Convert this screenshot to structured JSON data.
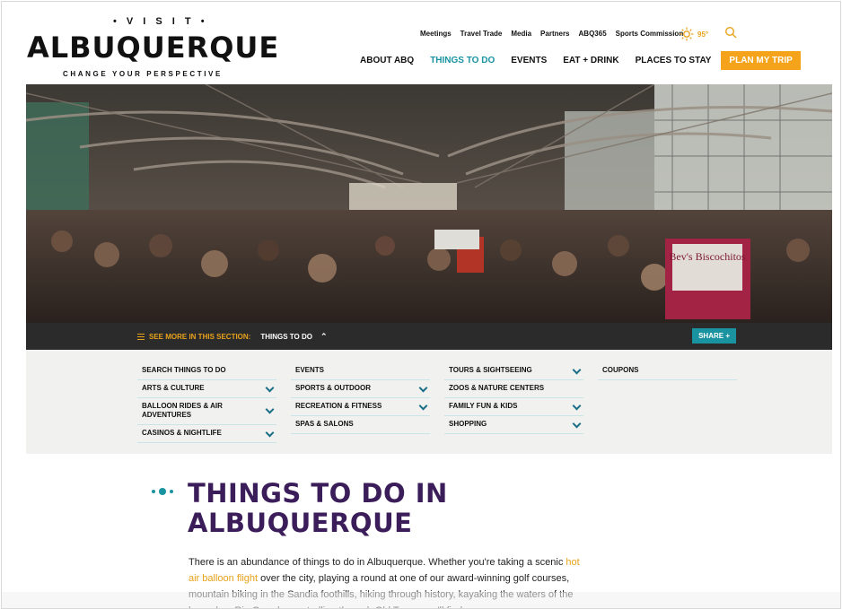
{
  "logo": {
    "visit": "• V I S I T •",
    "name": "ALBUQUERQUE",
    "tagline": "CHANGE YOUR PERSPECTIVE"
  },
  "utility_nav": [
    "Meetings",
    "Travel Trade",
    "Media",
    "Partners",
    "ABQ365",
    "Sports Commission"
  ],
  "weather": {
    "temp": "95°",
    "icon": "sun-icon"
  },
  "main_nav": {
    "items": [
      "ABOUT ABQ",
      "THINGS TO DO",
      "EVENTS",
      "EAT + DRINK",
      "PLACES TO STAY"
    ],
    "active": "THINGS TO DO",
    "cta": "PLAN MY TRIP"
  },
  "hero": {
    "sign": "Bev's Biscochitos"
  },
  "section_bar": {
    "see_more": "SEE MORE IN THIS SECTION:",
    "current": "THINGS TO DO",
    "share": "SHARE +"
  },
  "submenu": {
    "col1": [
      {
        "label": "SEARCH THINGS TO DO",
        "chevron": false
      },
      {
        "label": "ARTS & CULTURE",
        "chevron": true
      },
      {
        "label": "BALLOON RIDES & AIR ADVENTURES",
        "chevron": true
      },
      {
        "label": "CASINOS & NIGHTLIFE",
        "chevron": true
      }
    ],
    "col2": [
      {
        "label": "EVENTS",
        "chevron": false
      },
      {
        "label": "SPORTS & OUTDOOR",
        "chevron": true
      },
      {
        "label": "RECREATION & FITNESS",
        "chevron": true
      },
      {
        "label": "SPAS & SALONS",
        "chevron": false
      }
    ],
    "col3": [
      {
        "label": "TOURS & SIGHTSEEING",
        "chevron": true
      },
      {
        "label": "ZOOS & NATURE CENTERS",
        "chevron": false
      },
      {
        "label": "FAMILY FUN & KIDS",
        "chevron": true
      },
      {
        "label": "SHOPPING",
        "chevron": true
      }
    ],
    "col4": [
      {
        "label": "COUPONS",
        "chevron": false
      }
    ]
  },
  "content": {
    "title_line1": "THINGS TO DO IN",
    "title_line2": "ALBUQUERQUE",
    "p_before": "There is an abundance of things to do in Albuquerque. Whether you're taking a scenic ",
    "p_link": "hot air balloon flight",
    "p_after": " over the city, playing a round at one of our award-winning golf courses, mountain biking in the Sandia foothills, hiking through history, kayaking the waters of the legendary Rio Grande, or strolling through Old Town, you'll find"
  },
  "colors": {
    "accent": "#1a93a0",
    "cta": "#f5a31a",
    "title": "#3b1d5a"
  }
}
